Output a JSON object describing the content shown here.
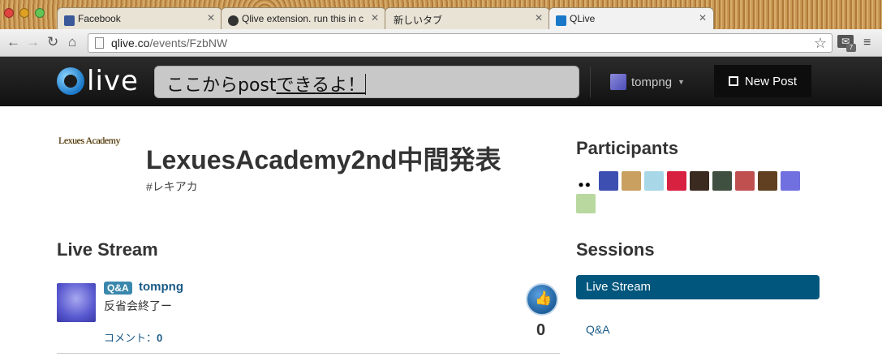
{
  "browser": {
    "tabs": [
      {
        "label": "Facebook",
        "favicon": "facebook-icon"
      },
      {
        "label": "Qlive extension. run this in c",
        "favicon": "github-icon"
      },
      {
        "label": "新しいタブ",
        "favicon": ""
      },
      {
        "label": "QLive",
        "favicon": "qlive-icon"
      }
    ],
    "url_host": "qlive.co",
    "url_path": "/events/FzbNW",
    "ext_badge": "7"
  },
  "site": {
    "logo_text": "live",
    "post_input_value": "ここからpost",
    "post_input_value_underlined": "できるよ！",
    "user_name": "tompng",
    "new_post_label": "New Post"
  },
  "event": {
    "logo_text": "Lexues Academy",
    "title": "LexuesAcademy2nd中間発表",
    "tag": "#レキアカ"
  },
  "live_stream": {
    "heading": "Live Stream",
    "posts": [
      {
        "badge": "Q&A",
        "author": "tompng",
        "text": "反省会終了ー",
        "comment_label": "コメント：",
        "comment_count": "0",
        "like_count": "0"
      }
    ]
  },
  "participants": {
    "heading": "Participants",
    "avatar_colors": [
      "#ffffff",
      "#3d4fb0",
      "#c9a060",
      "#a8d8e8",
      "#d82040",
      "#3a2a20",
      "#405040",
      "#c05050",
      "#604020",
      "#7070e0",
      "#b8d8a0"
    ]
  },
  "sessions": {
    "heading": "Sessions",
    "items": [
      "Live Stream",
      "Q&A"
    ]
  }
}
